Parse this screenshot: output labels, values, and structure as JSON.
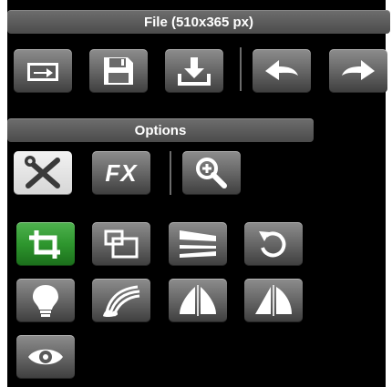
{
  "file_header": "File (510x365 px)",
  "options_header": "Options",
  "icons": {
    "open": "open-image-icon",
    "save": "save-icon",
    "download": "download-icon",
    "undo": "undo-arrow-icon",
    "redo": "redo-arrow-icon",
    "tools": "tools-icon",
    "fx": "fx-icon",
    "zoom": "zoom-in-icon",
    "crop": "crop-icon",
    "resize": "resize-icon",
    "perspective": "perspective-icon",
    "rotate": "rotate-icon",
    "brightness": "lightbulb-icon",
    "curves": "curves-icon",
    "flip_horizontal": "flip-horizontal-icon",
    "flip_vertical": "flip-vertical-icon",
    "preview": "eye-icon"
  },
  "fx_label": "FX",
  "colors": {
    "panel_bg": "#000000",
    "button": "#6a6a6a",
    "active_button": "#2e962e"
  }
}
